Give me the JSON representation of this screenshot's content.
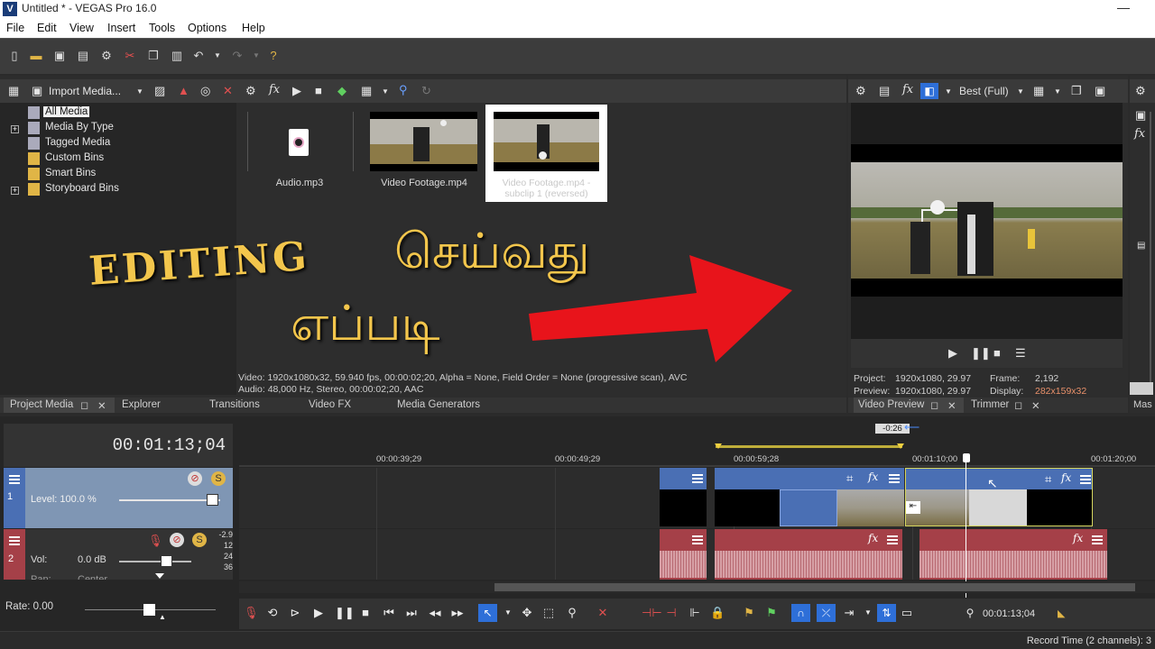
{
  "app": {
    "title": "Untitled * - VEGAS Pro 16.0",
    "logo": "V"
  },
  "menu": [
    "File",
    "Edit",
    "View",
    "Insert",
    "Tools",
    "Options",
    "Help"
  ],
  "media_panel": {
    "import_label": "Import Media...",
    "tree": [
      "All Media",
      "Media By Type",
      "Tagged Media",
      "Custom Bins",
      "Smart Bins",
      "Storyboard Bins"
    ],
    "files": [
      {
        "name": "Audio.mp3"
      },
      {
        "name": "Video Footage.mp4"
      },
      {
        "name": "Video Footage.mp4 - subclip 1 (reversed)"
      }
    ],
    "info_line1": "Video: 1920x1080x32, 59.940 fps, 00:00:02;20, Alpha = None, Field Order = None (progressive scan), AVC",
    "info_line2": "Audio: 48,000 Hz, Stereo, 00:00:02;20, AAC",
    "tabs": [
      "Project Media",
      "Explorer",
      "Transitions",
      "Video FX",
      "Media Generators"
    ]
  },
  "overlay": {
    "line1_en": "EDITING",
    "line1_ta": "செய்வது",
    "line2_ta": "எப்படி",
    "arrow_color": "#e8141b",
    "text_color": "#f3c64c"
  },
  "preview": {
    "quality": "Best (Full)",
    "project_label": "Project:",
    "project_value": "1920x1080, 29.97",
    "frame_label": "Frame:",
    "frame_value": "2,192",
    "preview_label": "Preview:",
    "preview_value": "1920x1080, 29.97",
    "display_label": "Display:",
    "display_value": "282x159x32",
    "tabs": [
      "Video Preview",
      "Trimmer"
    ],
    "side_tab": "Mas"
  },
  "timeline": {
    "timecode": "00:01:13;04",
    "loop_label": "-0:26",
    "ruler": [
      "00:00:39;29",
      "00:00:49;29",
      "00:00:59;28",
      "00:01:10;00",
      "00:01:20;00"
    ],
    "video_track": {
      "num": "1",
      "level": "Level: 100.0 %"
    },
    "audio_track": {
      "num": "2",
      "vol_label": "Vol:",
      "vol_value": "0.0 dB",
      "pan_label": "Pan:",
      "pan_value": "Center",
      "meter": [
        "-2.9",
        "12",
        "24",
        "36"
      ]
    },
    "rate": "Rate: 0.00",
    "transport_timecode": "00:01:13;04",
    "status": "Record Time (2 channels): 3"
  },
  "colors": {
    "video_clip": "#4a6fb4",
    "audio_clip": "#a54048",
    "selection": "#2e6fd8"
  }
}
